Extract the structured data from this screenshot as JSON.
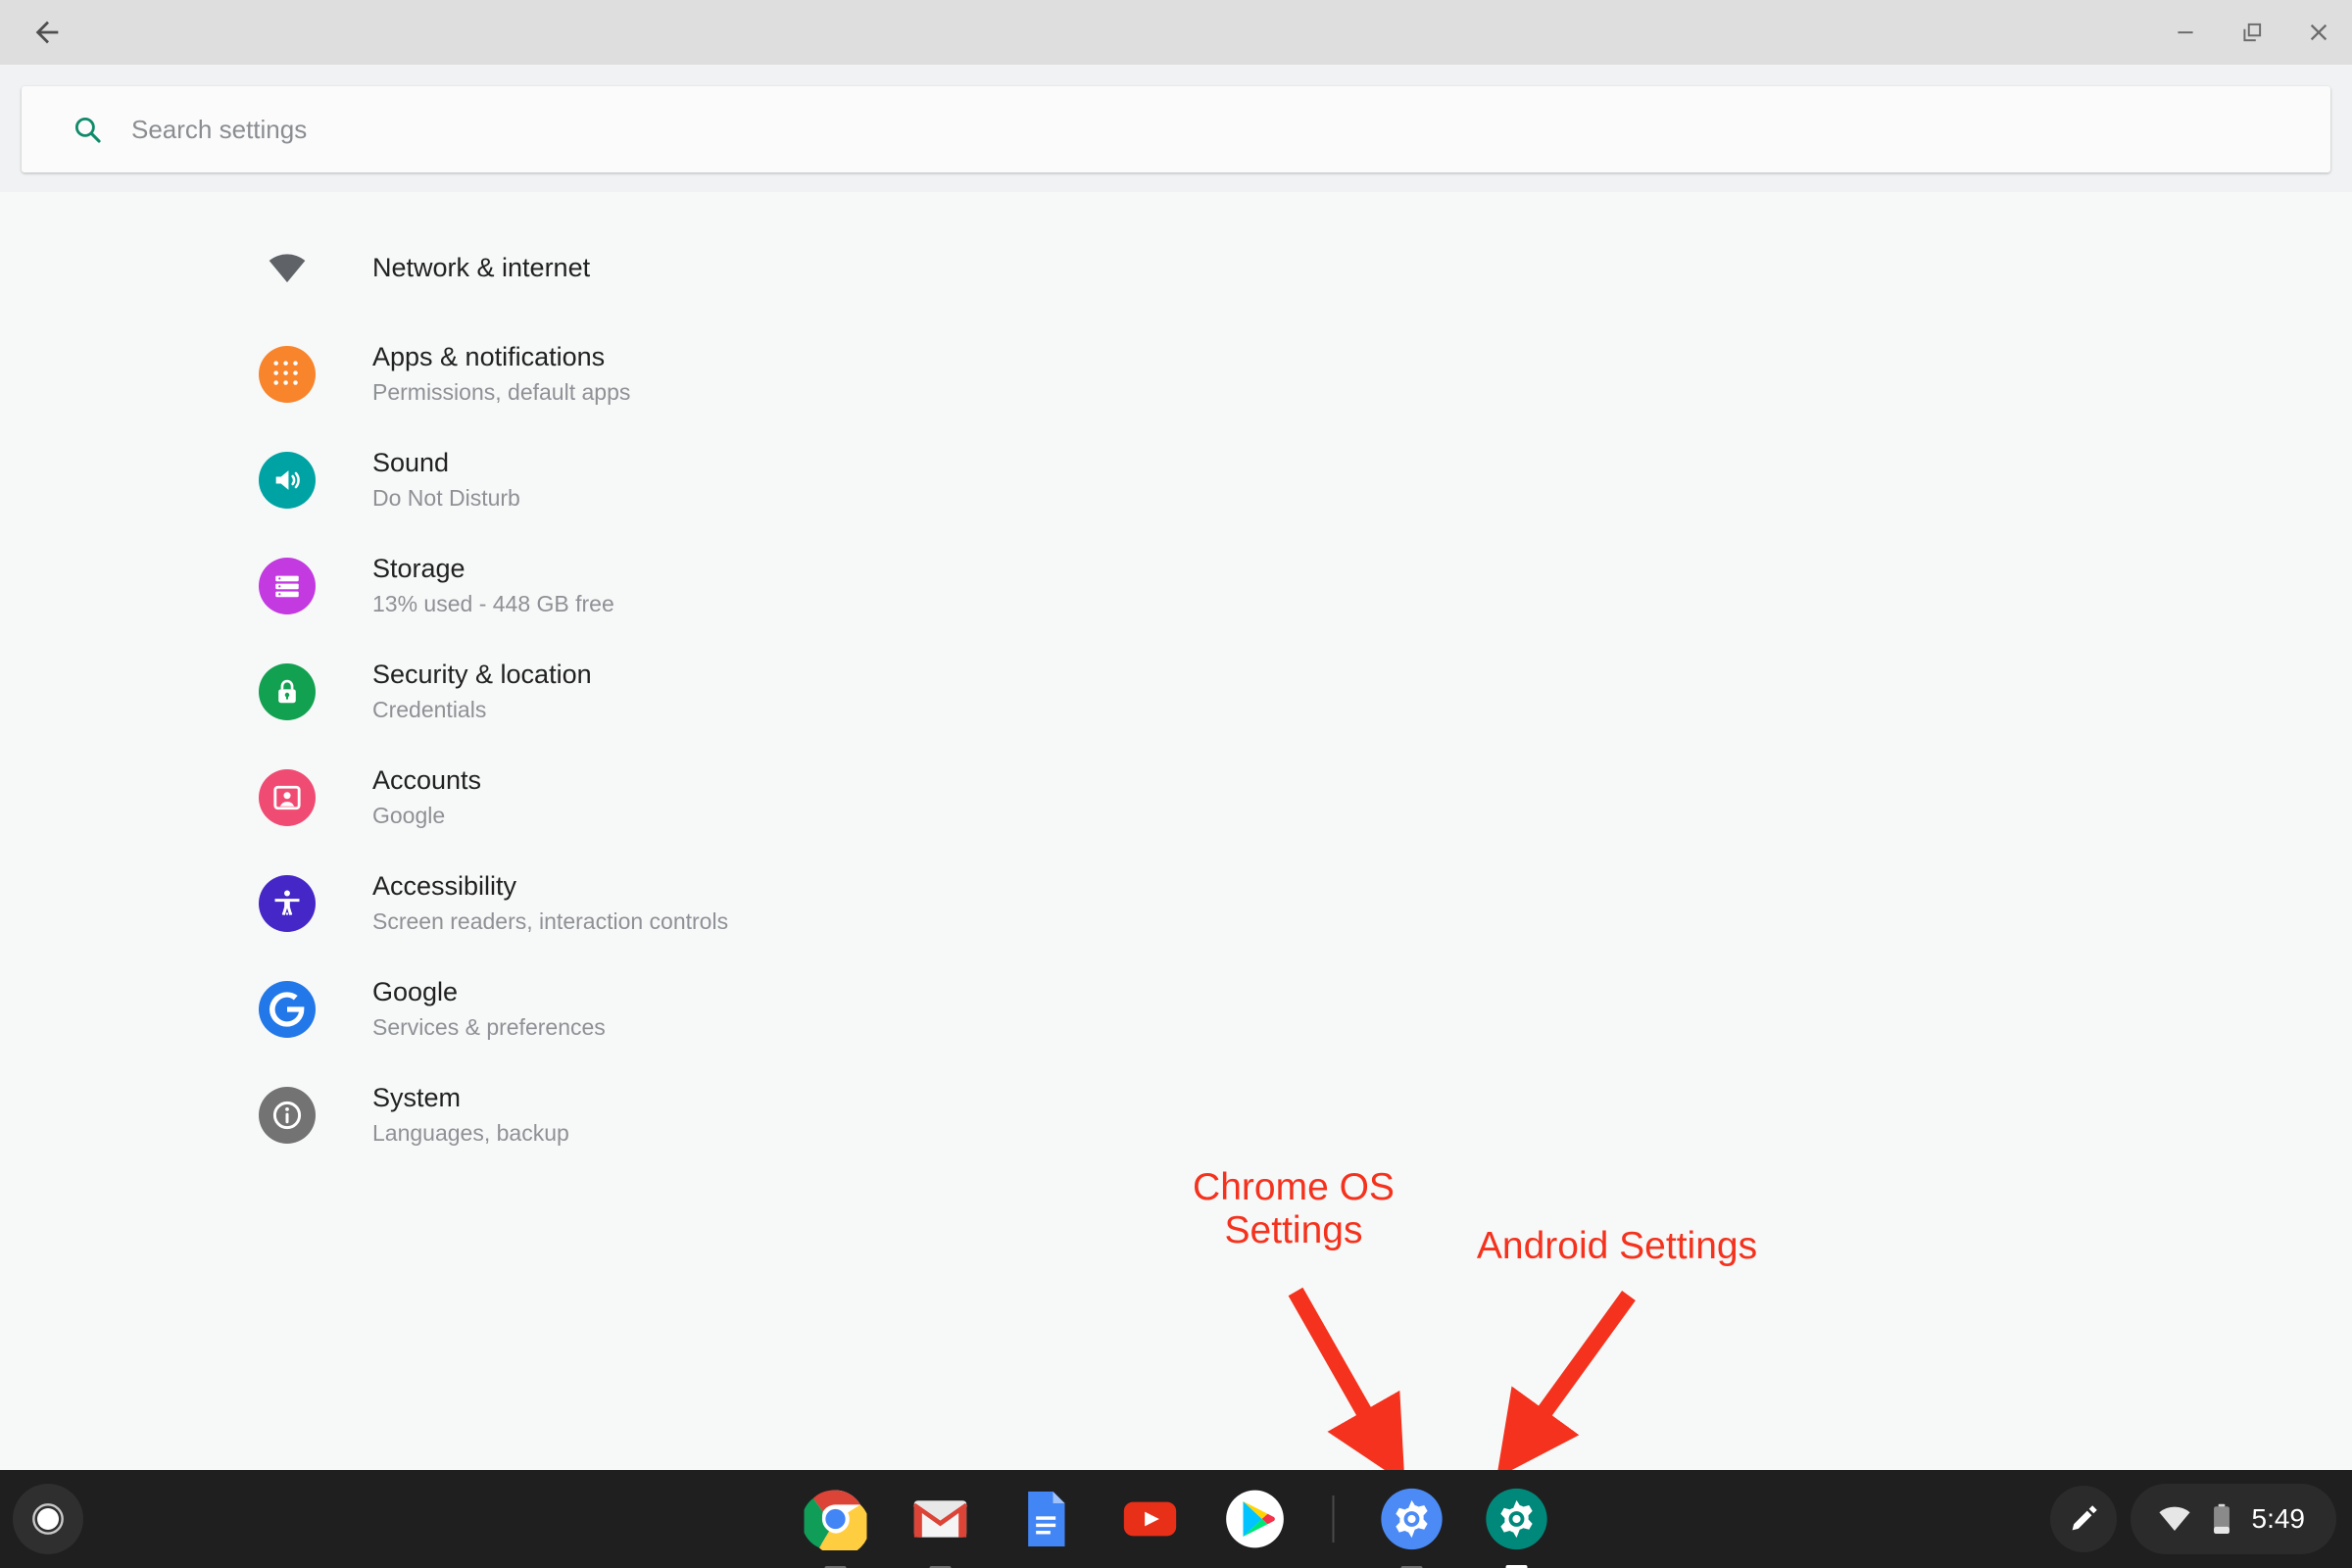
{
  "window": {
    "back_label": "Back",
    "controls": [
      {
        "name": "minimize",
        "label": "Minimize"
      },
      {
        "name": "restore",
        "label": "Restore"
      },
      {
        "name": "close",
        "label": "Close"
      }
    ]
  },
  "search": {
    "placeholder": "Search settings",
    "value": "",
    "icon": "search-icon",
    "icon_color": "#0f8a6a"
  },
  "settings_list": [
    {
      "id": "network-internet",
      "title": "Network & internet",
      "subtitle": "",
      "icon": "wifi-icon",
      "icon_color": "#5f6368",
      "icon_style": "plain"
    },
    {
      "id": "apps-notifications",
      "title": "Apps & notifications",
      "subtitle": "Permissions, default apps",
      "icon": "apps-grid-icon",
      "icon_color": "#f8842c"
    },
    {
      "id": "sound",
      "title": "Sound",
      "subtitle": "Do Not Disturb",
      "icon": "volume-icon",
      "icon_color": "#00a3a3"
    },
    {
      "id": "storage",
      "title": "Storage",
      "subtitle": "13% used - 448 GB free",
      "icon": "storage-icon",
      "icon_color": "#c23ae0"
    },
    {
      "id": "security-location",
      "title": "Security & location",
      "subtitle": "Credentials",
      "icon": "lock-icon",
      "icon_color": "#12a150"
    },
    {
      "id": "accounts",
      "title": "Accounts",
      "subtitle": "Google",
      "icon": "account-icon",
      "icon_color": "#f04c73"
    },
    {
      "id": "accessibility",
      "title": "Accessibility",
      "subtitle": "Screen readers, interaction controls",
      "icon": "accessibility-icon",
      "icon_color": "#4527c7"
    },
    {
      "id": "google",
      "title": "Google",
      "subtitle": "Services & preferences",
      "icon": "google-g-icon",
      "icon_color": "#2278e8"
    },
    {
      "id": "system",
      "title": "System",
      "subtitle": "Languages, backup",
      "icon": "info-icon",
      "icon_color": "#737373"
    }
  ],
  "annotations": {
    "color": "#f4321d",
    "chrome_os": "Chrome OS\nSettings",
    "android": "Android Settings"
  },
  "shelf": {
    "launcher": {
      "label": "Launcher",
      "icon": "launcher-circle-icon"
    },
    "apps": [
      {
        "id": "chrome",
        "label": "Chrome",
        "icon": "chrome-icon",
        "running": true
      },
      {
        "id": "gmail",
        "label": "Gmail",
        "icon": "gmail-icon",
        "running": true
      },
      {
        "id": "docs",
        "label": "Docs",
        "icon": "docs-icon",
        "running": false
      },
      {
        "id": "youtube",
        "label": "YouTube",
        "icon": "youtube-icon",
        "running": false
      },
      {
        "id": "play-store",
        "label": "Play Store",
        "icon": "play-store-icon",
        "running": false
      },
      {
        "id": "chromeos-settings",
        "label": "Chrome OS Settings",
        "icon": "gear-icon",
        "icon_color": "#4c8bf5",
        "running": true
      },
      {
        "id": "android-settings",
        "label": "Android Settings",
        "icon": "gear-icon",
        "icon_color": "#00897b",
        "running": true,
        "active": true
      }
    ],
    "stylus": {
      "label": "Stylus tools",
      "icon": "stylus-icon"
    },
    "status": {
      "wifi": "wifi-icon",
      "battery": "battery-icon",
      "time": "5:49"
    }
  }
}
